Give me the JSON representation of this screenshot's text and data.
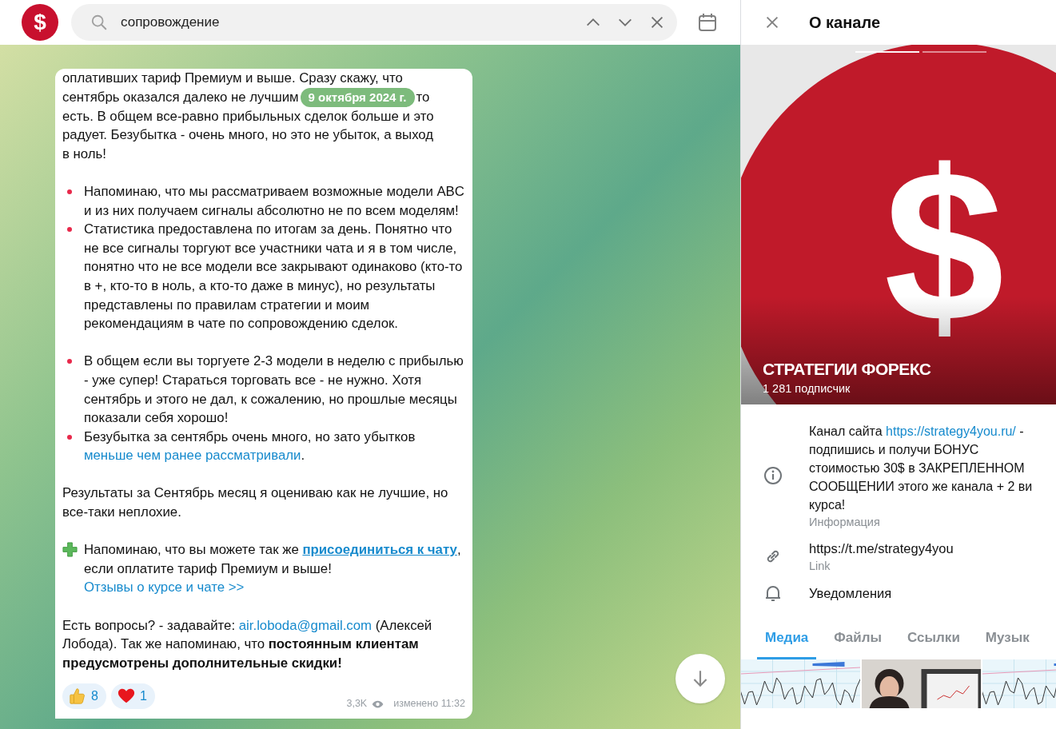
{
  "chat_header": {
    "avatar_symbol": "$",
    "search": {
      "value": "сопровождение"
    }
  },
  "message": {
    "first_lines": [
      "оплативших тариф Премиум и выше. Сразу скажу, что"
    ],
    "date_line": {
      "before": "сентябрь оказался далеко не лучшим",
      "date": "9 октября 2024 г.",
      "after": "то"
    },
    "rest_lines": [
      "есть. В общем все-равно прибыльных сделок больше и это",
      "радует. Безубытка - очень много, но это не убыток, а выход",
      "в ноль!"
    ],
    "sections": [
      [
        {
          "kind": "bullet",
          "parts": [
            {
              "kind": "plain",
              "text": "Напоминаю, что мы рассматриваем возможные модели ABC и из них получаем сигналы абсолютно не по всем моделям!"
            }
          ]
        },
        {
          "kind": "bullet",
          "parts": [
            {
              "kind": "plain",
              "text": "Статистика предоставлена по итогам за день. Понятно что не все сигналы торгуют все участники чата и я в том числе, понятно что не все модели все закрывают одинаково (кто-то в +, кто-то в ноль, а кто-то даже в минус), но результаты представлены по правилам стратегии и моим рекомендациям в чате по сопровождению сделок."
            }
          ]
        }
      ],
      [
        {
          "kind": "bullet",
          "parts": [
            {
              "kind": "plain",
              "text": "В общем если вы торгуете 2-3 модели в неделю с прибылью - уже супер! Стараться торговать все - не нужно. Хотя сентябрь и этого не дал, к сожалению, но прошлые месяцы показали себя хорошо!"
            }
          ]
        },
        {
          "kind": "bullet",
          "parts": [
            {
              "kind": "plain",
              "text": "Безубытка за сентябрь очень много, но зато убытков "
            },
            {
              "kind": "link",
              "text": "меньше чем ранее рассматривали"
            },
            {
              "kind": "plain",
              "text": "."
            }
          ]
        }
      ],
      [
        {
          "kind": "text",
          "parts": [
            {
              "kind": "plain",
              "text": "Результаты за Сентябрь месяц я оцениваю как не лучшие, но все-таки неплохие."
            }
          ]
        }
      ],
      [
        {
          "kind": "plus",
          "parts": [
            {
              "kind": "plain",
              "text": "Напоминаю, что вы можете так же "
            },
            {
              "kind": "strong_link",
              "text": "присоединиться к чату"
            },
            {
              "kind": "plain",
              "text": ", если оплатите тариф Премиум и выше!"
            }
          ]
        },
        {
          "kind": "indent",
          "parts": [
            {
              "kind": "link",
              "text": "Отзывы о курсе и чате >>"
            }
          ]
        }
      ],
      [
        {
          "kind": "text",
          "parts": [
            {
              "kind": "plain",
              "text": "Есть вопросы? - задавайте: "
            },
            {
              "kind": "link",
              "text": "air.loboda@gmail.com"
            },
            {
              "kind": "plain",
              "text": " (Алексей Лобода). Так же напоминаю, что **постоянным клиентам предусмотрены дополнительные скидки!**"
            }
          ]
        }
      ]
    ],
    "reactions": [
      {
        "kind": "thumbs",
        "count": "8"
      },
      {
        "kind": "heart",
        "count": "1"
      }
    ],
    "views": "3,3K",
    "edited": "изменено 11:32"
  },
  "panel": {
    "title": "О канале",
    "photos": [
      {
        "selected": true
      },
      {
        "selected": false
      }
    ],
    "avatar_symbol": "$",
    "channel_name": "СТРАТЕГИИ ФОРЕКС",
    "subscribers": "1 281 подписчик",
    "info": [
      {
        "kind": "info",
        "before": "Канал сайта ",
        "link": "https://strategy4you.ru/",
        "after": " -\nподпишись и получи БОНУС\nстоимостью 30$ в ЗАКРЕПЛЕННОМ\nСООБЩЕНИИ этого же канала + 2 ви\nкурса!",
        "caption": "Информация"
      },
      {
        "kind": "link",
        "value": "https://t.me/strategy4you",
        "caption": "Link"
      },
      {
        "kind": "bell",
        "value": "Уведомления"
      }
    ],
    "tabs": [
      {
        "label": "Медиа",
        "selected": true
      },
      {
        "label": "Файлы",
        "selected": false
      },
      {
        "label": "Ссылки",
        "selected": false
      },
      {
        "label": "Музык",
        "selected": false
      }
    ],
    "media": [
      {
        "kind": "chart"
      },
      {
        "kind": "person"
      },
      {
        "kind": "chart"
      }
    ]
  }
}
